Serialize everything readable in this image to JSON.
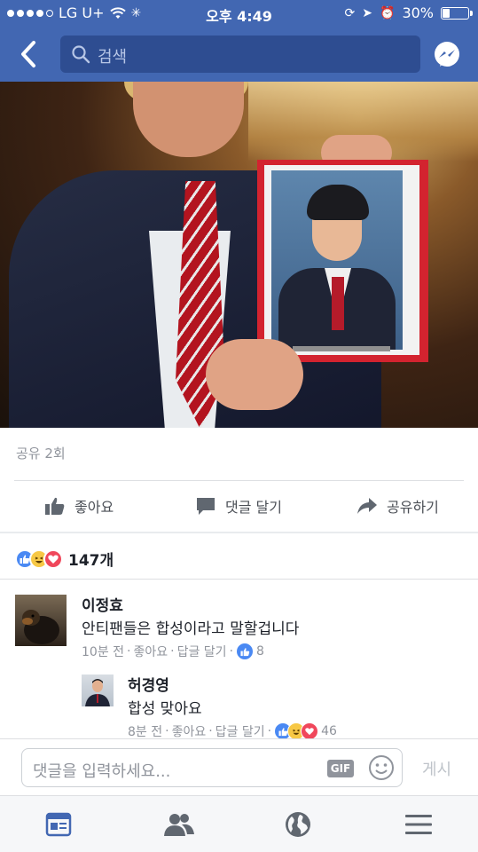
{
  "status_bar": {
    "carrier": "LG U+",
    "time": "오후 4:49",
    "battery_text": "30%",
    "battery_level": 0.3
  },
  "header": {
    "search_placeholder": "검색"
  },
  "post": {
    "shares_text": "공유 2회",
    "actions": {
      "like": "좋아요",
      "comment": "댓글 달기",
      "share": "공유하기"
    },
    "reaction_count": "147개"
  },
  "comments": [
    {
      "name": "이정효",
      "text": "안티팬들은 합성이라고 말할겁니다",
      "time": "10분 전",
      "like": "좋아요",
      "reply": "답글 달기",
      "reaction_count": "8"
    },
    {
      "name": "허경영",
      "text": "합성 맞아요",
      "time": "8분 전",
      "like": "좋아요",
      "reply": "답글 달기",
      "reaction_count": "46"
    }
  ],
  "composer": {
    "placeholder": "댓글을 입력하세요...",
    "gif_label": "GIF",
    "post_label": "게시"
  },
  "colors": {
    "brand": "#4267b2",
    "like_blue": "#4a89f3",
    "love_red": "#f0475b",
    "haha_yellow": "#f7c845"
  },
  "icons": [
    "back-icon",
    "search-icon",
    "messenger-icon",
    "thumbs-up-icon",
    "comment-bubble-icon",
    "share-arrow-icon",
    "emoji-icon",
    "news-feed-icon",
    "friends-icon",
    "globe-icon",
    "menu-icon"
  ]
}
